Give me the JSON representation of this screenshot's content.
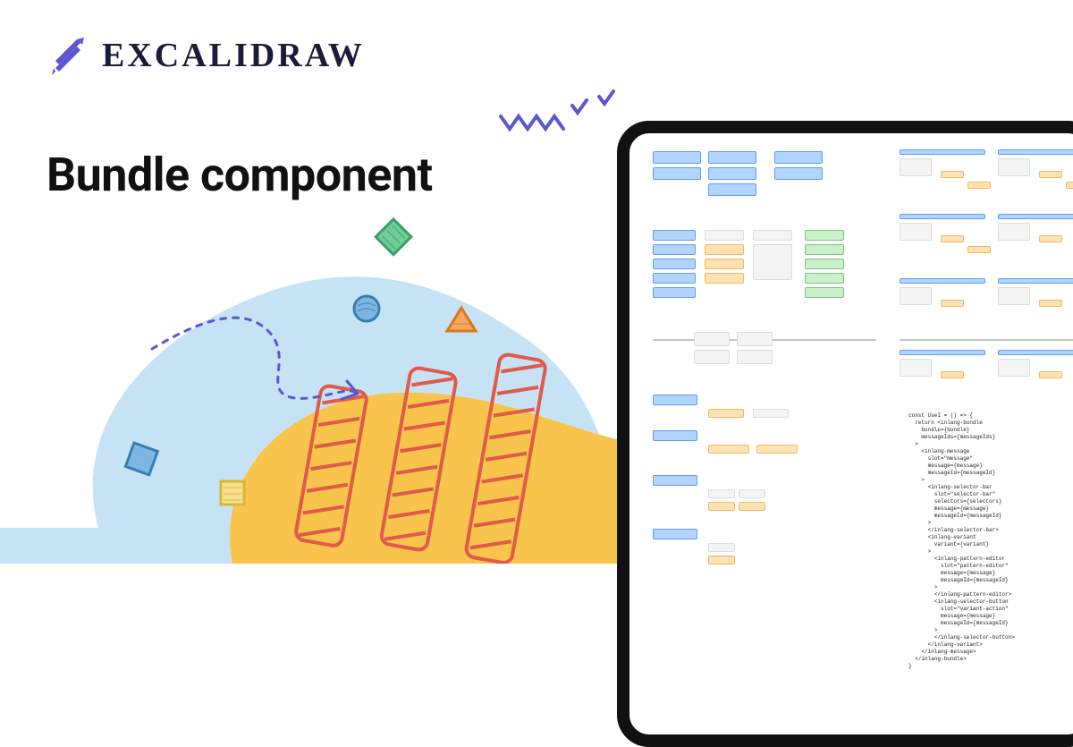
{
  "brand": {
    "name": "EXCALIDRAW"
  },
  "headline": "Bundle component",
  "tablet": {
    "canvas_description": "Zoomed-out Excalidraw whiteboard with many small labeled boxes, connectors, and a code snippet",
    "code_snippet": "const UseI = () => {\n  return <inlang-bundle\n    bundle={bundle}\n    messageIds={messageIds}\n  >\n    <inlang-message\n      slot=\"message\"\n      message={message}\n      messageId={messageId}\n    >\n      <inlang-selector-bar\n        slot=\"selector-bar\"\n        selectors={selectors}\n        message={message}\n        messageId={messageId}\n      >\n      </inlang-selector-bar>\n      <inlang-variant\n        variant={variant}\n      >\n        <inlang-pattern-editor\n          slot=\"pattern-editor\"\n          message={message}\n          messageId={messageId}\n        >\n        </inlang-pattern-editor>\n        <inlang-selector-button\n          slot=\"variant-action\"\n          message={message}\n          messageId={messageId}\n        >\n        </inlang-selector-button>\n      </inlang-variant>\n    </inlang-message>\n  </inlang-bundle>\n}"
  },
  "decorations": {
    "shapes": [
      "diamond-green",
      "square-yellow",
      "circle-blue",
      "triangle-orange",
      "dashed-arrow",
      "zigzag-purple",
      "checkmarks-purple"
    ]
  },
  "colors": {
    "brand_purple": "#5b57d1",
    "yellow_blob": "#f8c44c",
    "blue_blob": "#c3e1f6",
    "red_stripe": "#e05b4a"
  }
}
